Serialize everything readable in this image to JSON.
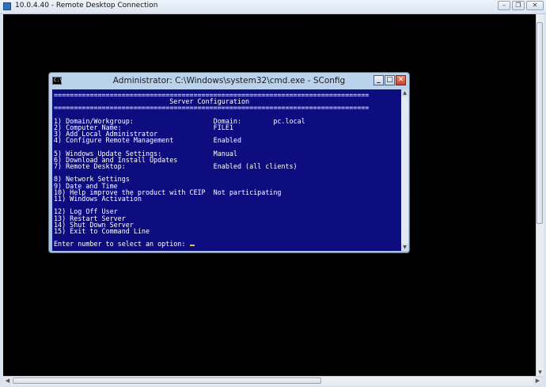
{
  "rdp": {
    "title": "10.0.4.40 - Remote Desktop Connection",
    "controls": {
      "minimize": "–",
      "restore": "❐",
      "close": "✕"
    }
  },
  "cmd": {
    "title": "Administrator: C:\\Windows\\system32\\cmd.exe - SConfig",
    "icon_text": "C:\\",
    "controls": {
      "minimize": "_",
      "maximize": "□",
      "close": "✕"
    }
  },
  "console": {
    "lines": [
      "===============================================================================",
      "                             Server Configuration",
      "===============================================================================",
      "",
      "1) Domain/Workgroup:                    Domain:        pc.local",
      "2) Computer Name:                       FILE1",
      "3) Add Local Administrator",
      "4) Configure Remote Management          Enabled",
      "",
      "5) Windows Update Settings:             Manual",
      "6) Download and Install Updates",
      "7) Remote Desktop:                      Enabled (all clients)",
      "",
      "8) Network Settings",
      "9) Date and Time",
      "10) Help improve the product with CEIP  Not participating",
      "11) Windows Activation",
      "",
      "12) Log Off User",
      "13) Restart Server",
      "14) Shut Down Server",
      "15) Exit to Command Line",
      "",
      "Enter number to select an option: "
    ]
  },
  "colors": {
    "console_bg": "#0d0d80",
    "console_fg": "#ffffff",
    "cursor": "#d8c23a"
  }
}
